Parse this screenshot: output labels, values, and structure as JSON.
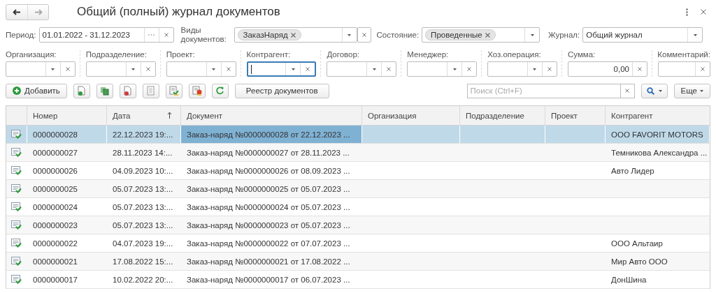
{
  "window": {
    "title": "Общий (полный) журнал документов"
  },
  "filters_top": [
    {
      "label": "Период:",
      "kind": "period",
      "value": "01.01.2022 - 31.12.2023"
    },
    {
      "label": "Виды документов:",
      "kind": "chips",
      "chips": [
        "ЗаказНаряд"
      ]
    },
    {
      "label": "Состояние:",
      "kind": "chips",
      "chips": [
        "Проведенные"
      ]
    },
    {
      "label": "Журнал:",
      "kind": "select",
      "value": "Общий журнал"
    }
  ],
  "filters": [
    {
      "label": "Организация:",
      "kind": "select",
      "focused": false
    },
    {
      "label": "Подразделение:",
      "kind": "select",
      "focused": false
    },
    {
      "label": "Проект:",
      "kind": "select",
      "focused": false
    },
    {
      "label": "Контрагент:",
      "kind": "select",
      "focused": true
    },
    {
      "label": "Договор:",
      "kind": "select",
      "focused": false
    },
    {
      "label": "Менеджер:",
      "kind": "select",
      "focused": false
    },
    {
      "label": "Хоз.операция:",
      "kind": "select",
      "focused": false
    },
    {
      "label": "Сумма:",
      "kind": "number",
      "value": "0,00",
      "focused": false
    },
    {
      "label": "Комментарий:",
      "kind": "text",
      "focused": false
    }
  ],
  "toolbar": {
    "add_button": "Добавить",
    "register_button": "Реестр документов",
    "search": {
      "placeholder": "Поиск (Ctrl+F)"
    },
    "more_button": "Еще"
  },
  "table": {
    "columns": [
      {
        "label": "Номер",
        "sorted": false
      },
      {
        "label": "Дата",
        "sorted": true
      },
      {
        "label": "Документ",
        "sorted": false
      },
      {
        "label": "Организация",
        "sorted": false
      },
      {
        "label": "Подразделение",
        "sorted": false
      },
      {
        "label": "Проект",
        "sorted": false
      },
      {
        "label": "Контрагент",
        "sorted": false
      }
    ],
    "rows": [
      {
        "selected": true,
        "posted": true,
        "cells": [
          "0000000028",
          "22.12.2023 19:...",
          "Заказ-наряд №0000000028  от 22.12.2023 ...",
          null,
          null,
          null,
          "ООО FAVORIT MOTORS"
        ]
      },
      {
        "selected": false,
        "posted": true,
        "cells": [
          "0000000027",
          "28.11.2023 14:...",
          "Заказ-наряд №0000000027  от 28.11.2023 ...",
          null,
          null,
          null,
          "Темникова Александра ..."
        ]
      },
      {
        "selected": false,
        "posted": true,
        "cells": [
          "0000000026",
          "04.09.2023 10:...",
          "Заказ-наряд №0000000026  от 08.09.2023 ...",
          null,
          null,
          null,
          "Авто Лидер"
        ]
      },
      {
        "selected": false,
        "posted": true,
        "cells": [
          "0000000025",
          "05.07.2023 13:...",
          "Заказ-наряд №0000000025  от 05.07.2023 ...",
          null,
          null,
          null,
          null
        ]
      },
      {
        "selected": false,
        "posted": true,
        "cells": [
          "0000000024",
          "05.07.2023 13:...",
          "Заказ-наряд №0000000024  от 05.07.2023 ...",
          null,
          null,
          null,
          null
        ]
      },
      {
        "selected": false,
        "posted": true,
        "cells": [
          "0000000023",
          "05.07.2023 13:...",
          "Заказ-наряд №0000000023  от 05.07.2023 ...",
          null,
          null,
          null,
          null
        ]
      },
      {
        "selected": false,
        "posted": true,
        "cells": [
          "0000000022",
          "04.07.2023 19:...",
          "Заказ-наряд №0000000022  от 07.07.2023 ...",
          null,
          null,
          null,
          "ООО Альтаир"
        ]
      },
      {
        "selected": false,
        "posted": true,
        "cells": [
          "0000000021",
          "17.08.2022 15:...",
          "Заказ-наряд №0000000021  от 17.08.2022 ...",
          null,
          null,
          null,
          "Мир Авто ООО"
        ]
      },
      {
        "selected": false,
        "posted": true,
        "cells": [
          "0000000017",
          "10.02.2022 20:...",
          "Заказ-наряд №0000000017  от 06.07.2023 ...",
          null,
          null,
          null,
          "ДонШина"
        ]
      }
    ]
  }
}
